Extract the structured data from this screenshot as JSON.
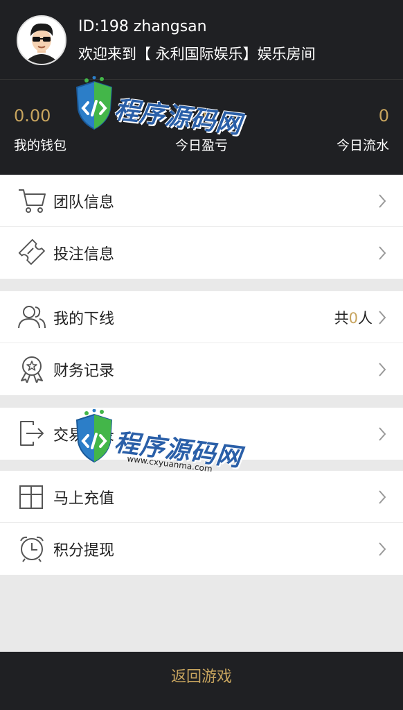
{
  "header": {
    "user_id": "ID:198 zhangsan",
    "welcome": "欢迎来到【 永利国际娱乐】娱乐房间"
  },
  "stats": {
    "wallet": {
      "value": "0.00",
      "label": "我的钱包"
    },
    "today_profit": {
      "value": "0",
      "label": "今日盈亏"
    },
    "today_flow": {
      "value": "0",
      "label": "今日流水"
    }
  },
  "menu": {
    "team_info": "团队信息",
    "bet_info": "投注信息",
    "my_downline": "我的下线",
    "downline_prefix": "共",
    "downline_count": "0",
    "downline_suffix": "人",
    "finance_records": "财务记录",
    "transaction": "交易记录",
    "recharge": "马上充值",
    "points_withdraw": "积分提现"
  },
  "footer": {
    "back_to_game": "返回游戏"
  },
  "watermark": {
    "text": "程序源码网",
    "url": "www.cxyuanma.com"
  },
  "colors": {
    "dark_bg": "#1f2023",
    "accent_gold": "#c7a45e"
  }
}
